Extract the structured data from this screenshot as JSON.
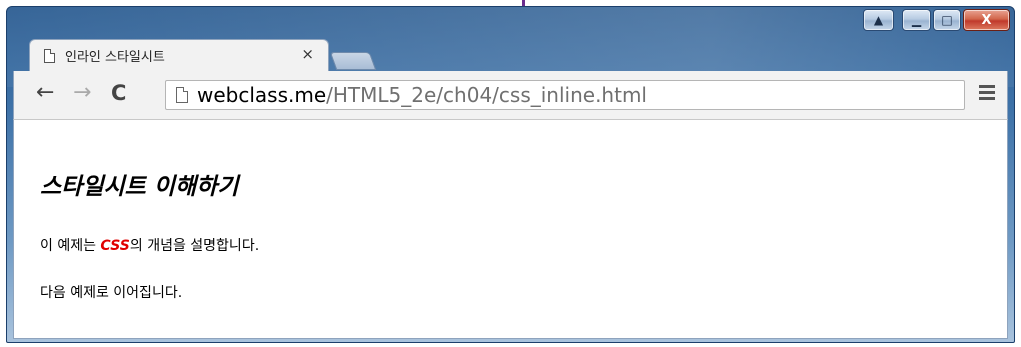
{
  "window": {
    "caption_buttons": {
      "user_glyph": "▲",
      "minimize_glyph": "▁",
      "maximize_glyph": "□",
      "close_glyph": "X"
    },
    "accent_color": "#2c5d92",
    "close_color": "#c0392b"
  },
  "tab": {
    "title": "인라인 스타일시트",
    "close_glyph": "×",
    "icon": "page-icon"
  },
  "toolbar": {
    "back_glyph": "←",
    "forward_glyph": "→",
    "reload_glyph": "C",
    "url_domain": "webclass.me",
    "url_path": "/HTML5_2e/ch04/css_inline.html",
    "menu_icon": "hamburger-icon"
  },
  "page": {
    "heading": "스타일시트 이해하기",
    "para1_before": "이 예제는 ",
    "para1_css": "CSS",
    "para1_after": "의 개념을 설명합니다.",
    "para2": "다음 예제로 이어집니다.",
    "highlight_color": "#e00000"
  }
}
